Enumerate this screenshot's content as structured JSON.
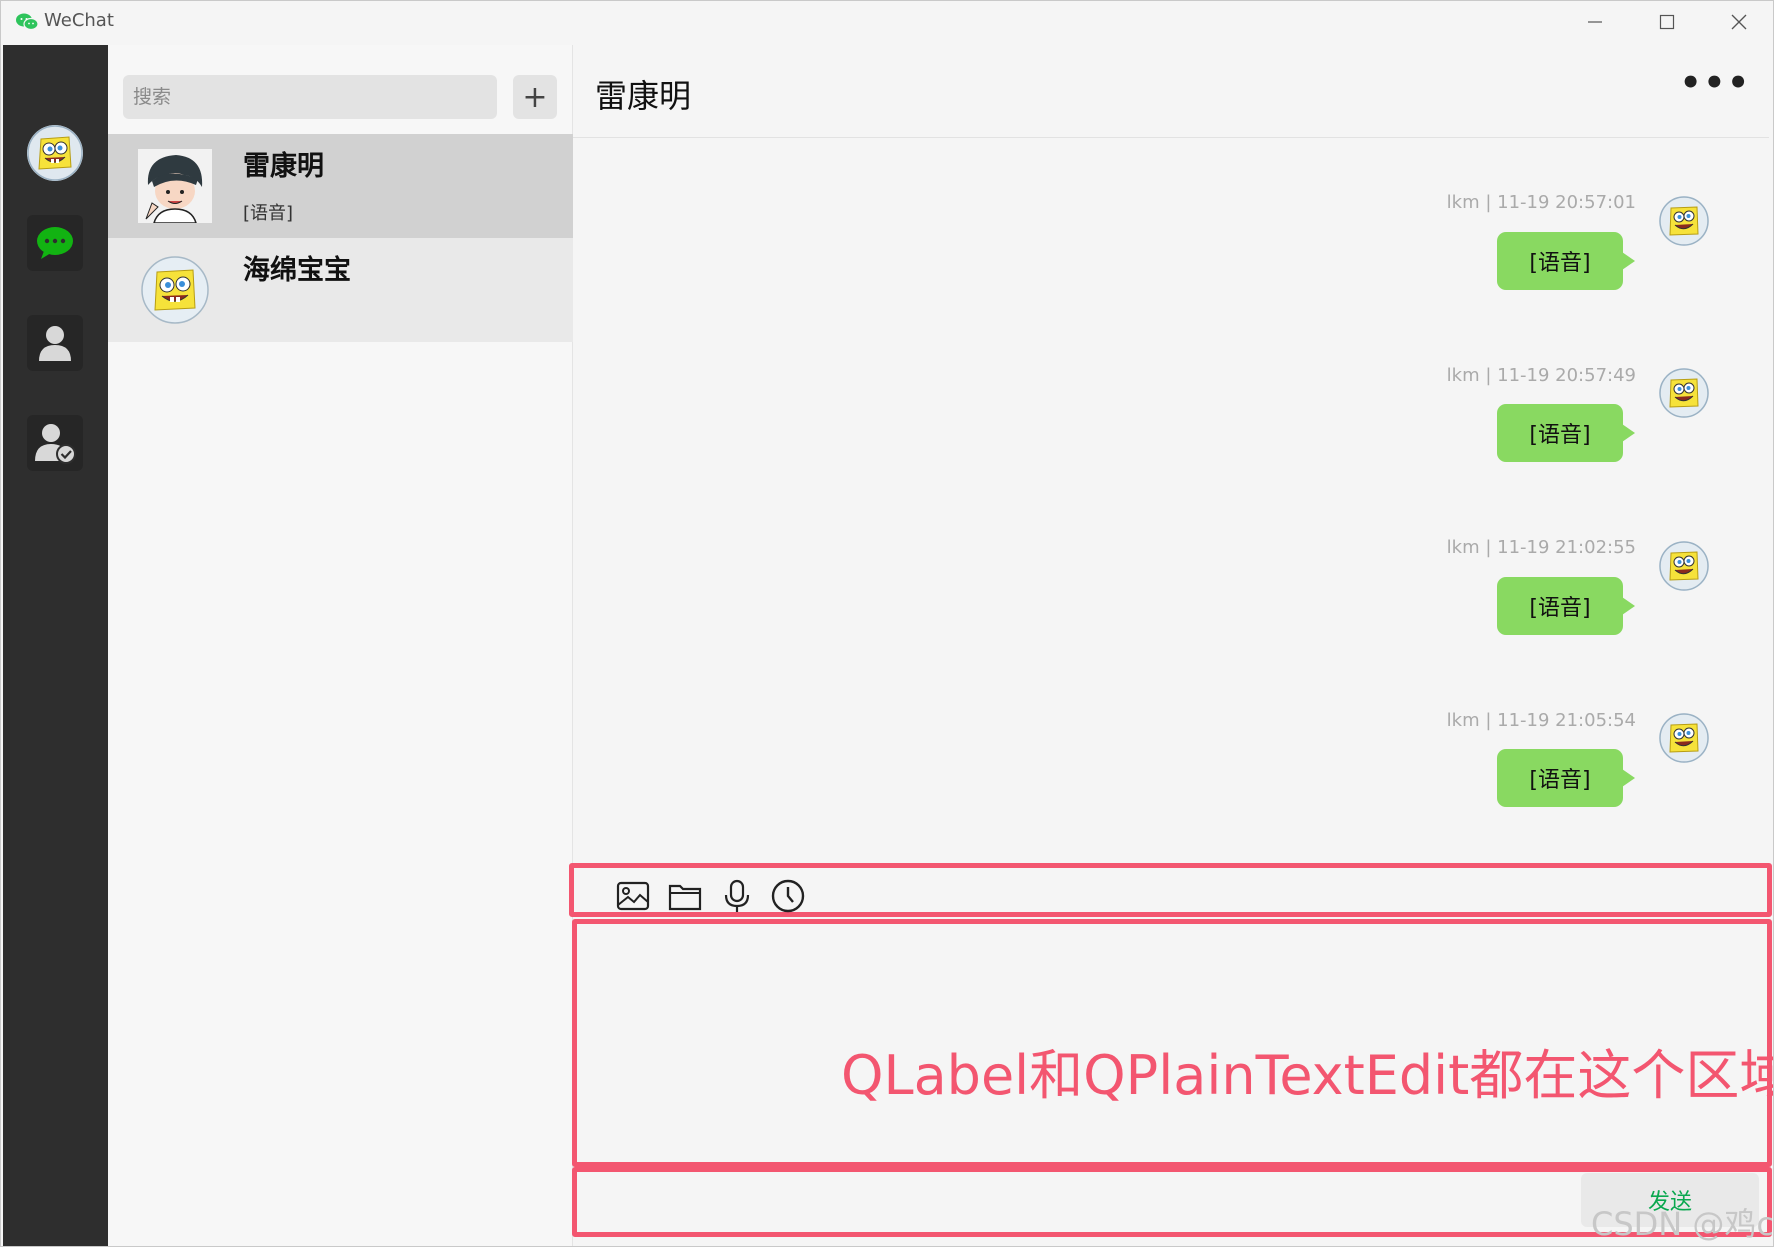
{
  "app": {
    "title": "WeChat",
    "brand_color": "#2ec45c"
  },
  "window_controls": {
    "minimize": "—",
    "maximize": "☐",
    "close": "✕"
  },
  "sidebar": {
    "items": [
      {
        "name": "user-avatar",
        "icon": "spongebob-avatar"
      },
      {
        "name": "chats",
        "icon": "chat-bubble-icon",
        "active": true
      },
      {
        "name": "contacts",
        "icon": "person-icon"
      },
      {
        "name": "friend-requests",
        "icon": "person-check-icon"
      }
    ]
  },
  "list": {
    "search_placeholder": "搜索",
    "add_label": "+",
    "contacts": [
      {
        "name": "雷康明",
        "last_message": "[语音]",
        "selected": true
      },
      {
        "name": "海绵宝宝",
        "last_message": "",
        "selected": false
      }
    ]
  },
  "chat": {
    "title": "雷康明",
    "more_label": "•••",
    "messages": [
      {
        "meta": "lkm | 11-19 20:57:01",
        "text": "[语音]"
      },
      {
        "meta": "lkm | 11-19 20:57:49",
        "text": "[语音]"
      },
      {
        "meta": "lkm | 11-19 21:02:55",
        "text": "[语音]"
      },
      {
        "meta": "lkm | 11-19 21:05:54",
        "text": "[语音]"
      }
    ],
    "bubble_color": "#89d961"
  },
  "toolbar": {
    "tools": [
      "image-icon",
      "folder-icon",
      "microphone-icon",
      "clock-icon"
    ]
  },
  "input": {
    "annotation": "QLabel和QPlainTextEdit都在这个区域",
    "annotation_color": "#f35670"
  },
  "send": {
    "label": "发送",
    "label_color": "#0aa84f"
  },
  "watermark": "CSDN @鸡c"
}
